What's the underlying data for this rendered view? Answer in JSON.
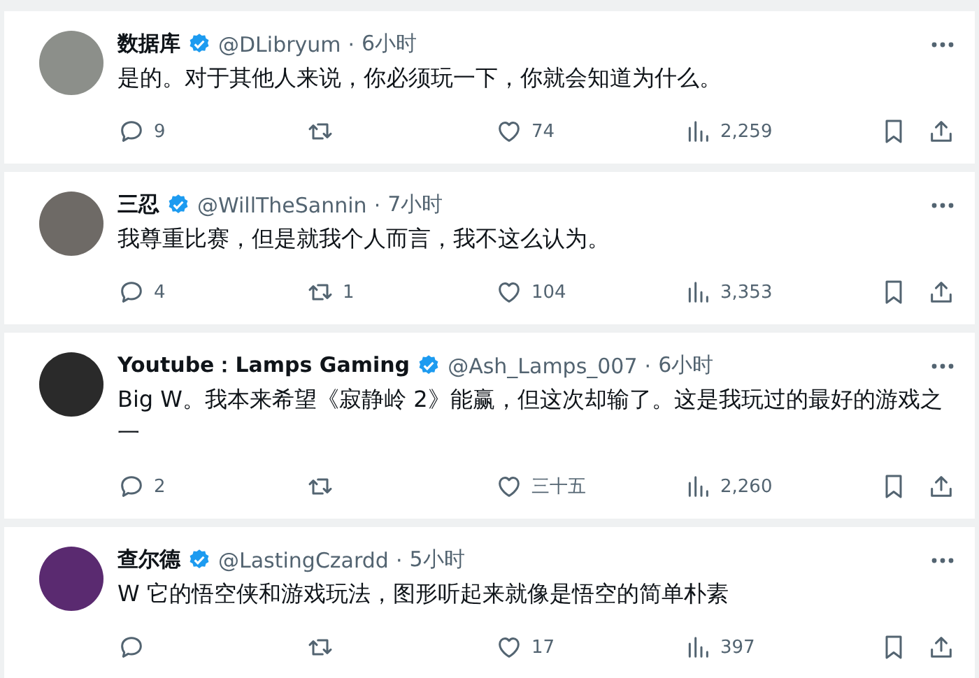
{
  "tweets": [
    {
      "name": "数据库",
      "verified": true,
      "handle": "@DLibryum",
      "separator": "·",
      "time": "6小时",
      "text": "是的。对于其他人来说，你必须玩一下，你就会知道为什么。",
      "replies": "9",
      "likes": "74",
      "views": "2,259"
    },
    {
      "name": "三忍",
      "verified": true,
      "handle": "@WillTheSannin",
      "separator": "·",
      "time": "7小时",
      "text": "我尊重比赛，但是就我个人而言，我不这么认为。",
      "replies": "4",
      "reposts": "1",
      "likes": "104",
      "views": "3,353"
    },
    {
      "name": "Youtube：Lamps Gaming",
      "verified": true,
      "handle": "@Ash_Lamps_007",
      "separator": "·",
      "time": "6小时",
      "text": "Big W。我本来希望《寂静岭 2》能赢，但这次却输了。这是我玩过的最好的游戏之一",
      "replies": "2",
      "likes": "三十五",
      "views": "2,260"
    },
    {
      "name": "查尔德",
      "verified": true,
      "handle": "@LastingCzardd",
      "separator": "·",
      "time": "5小时",
      "text": "W 它的悟空侠和游戏玩法，图形听起来就像是悟空的简单朴素",
      "likes": "17",
      "views": "397"
    }
  ]
}
